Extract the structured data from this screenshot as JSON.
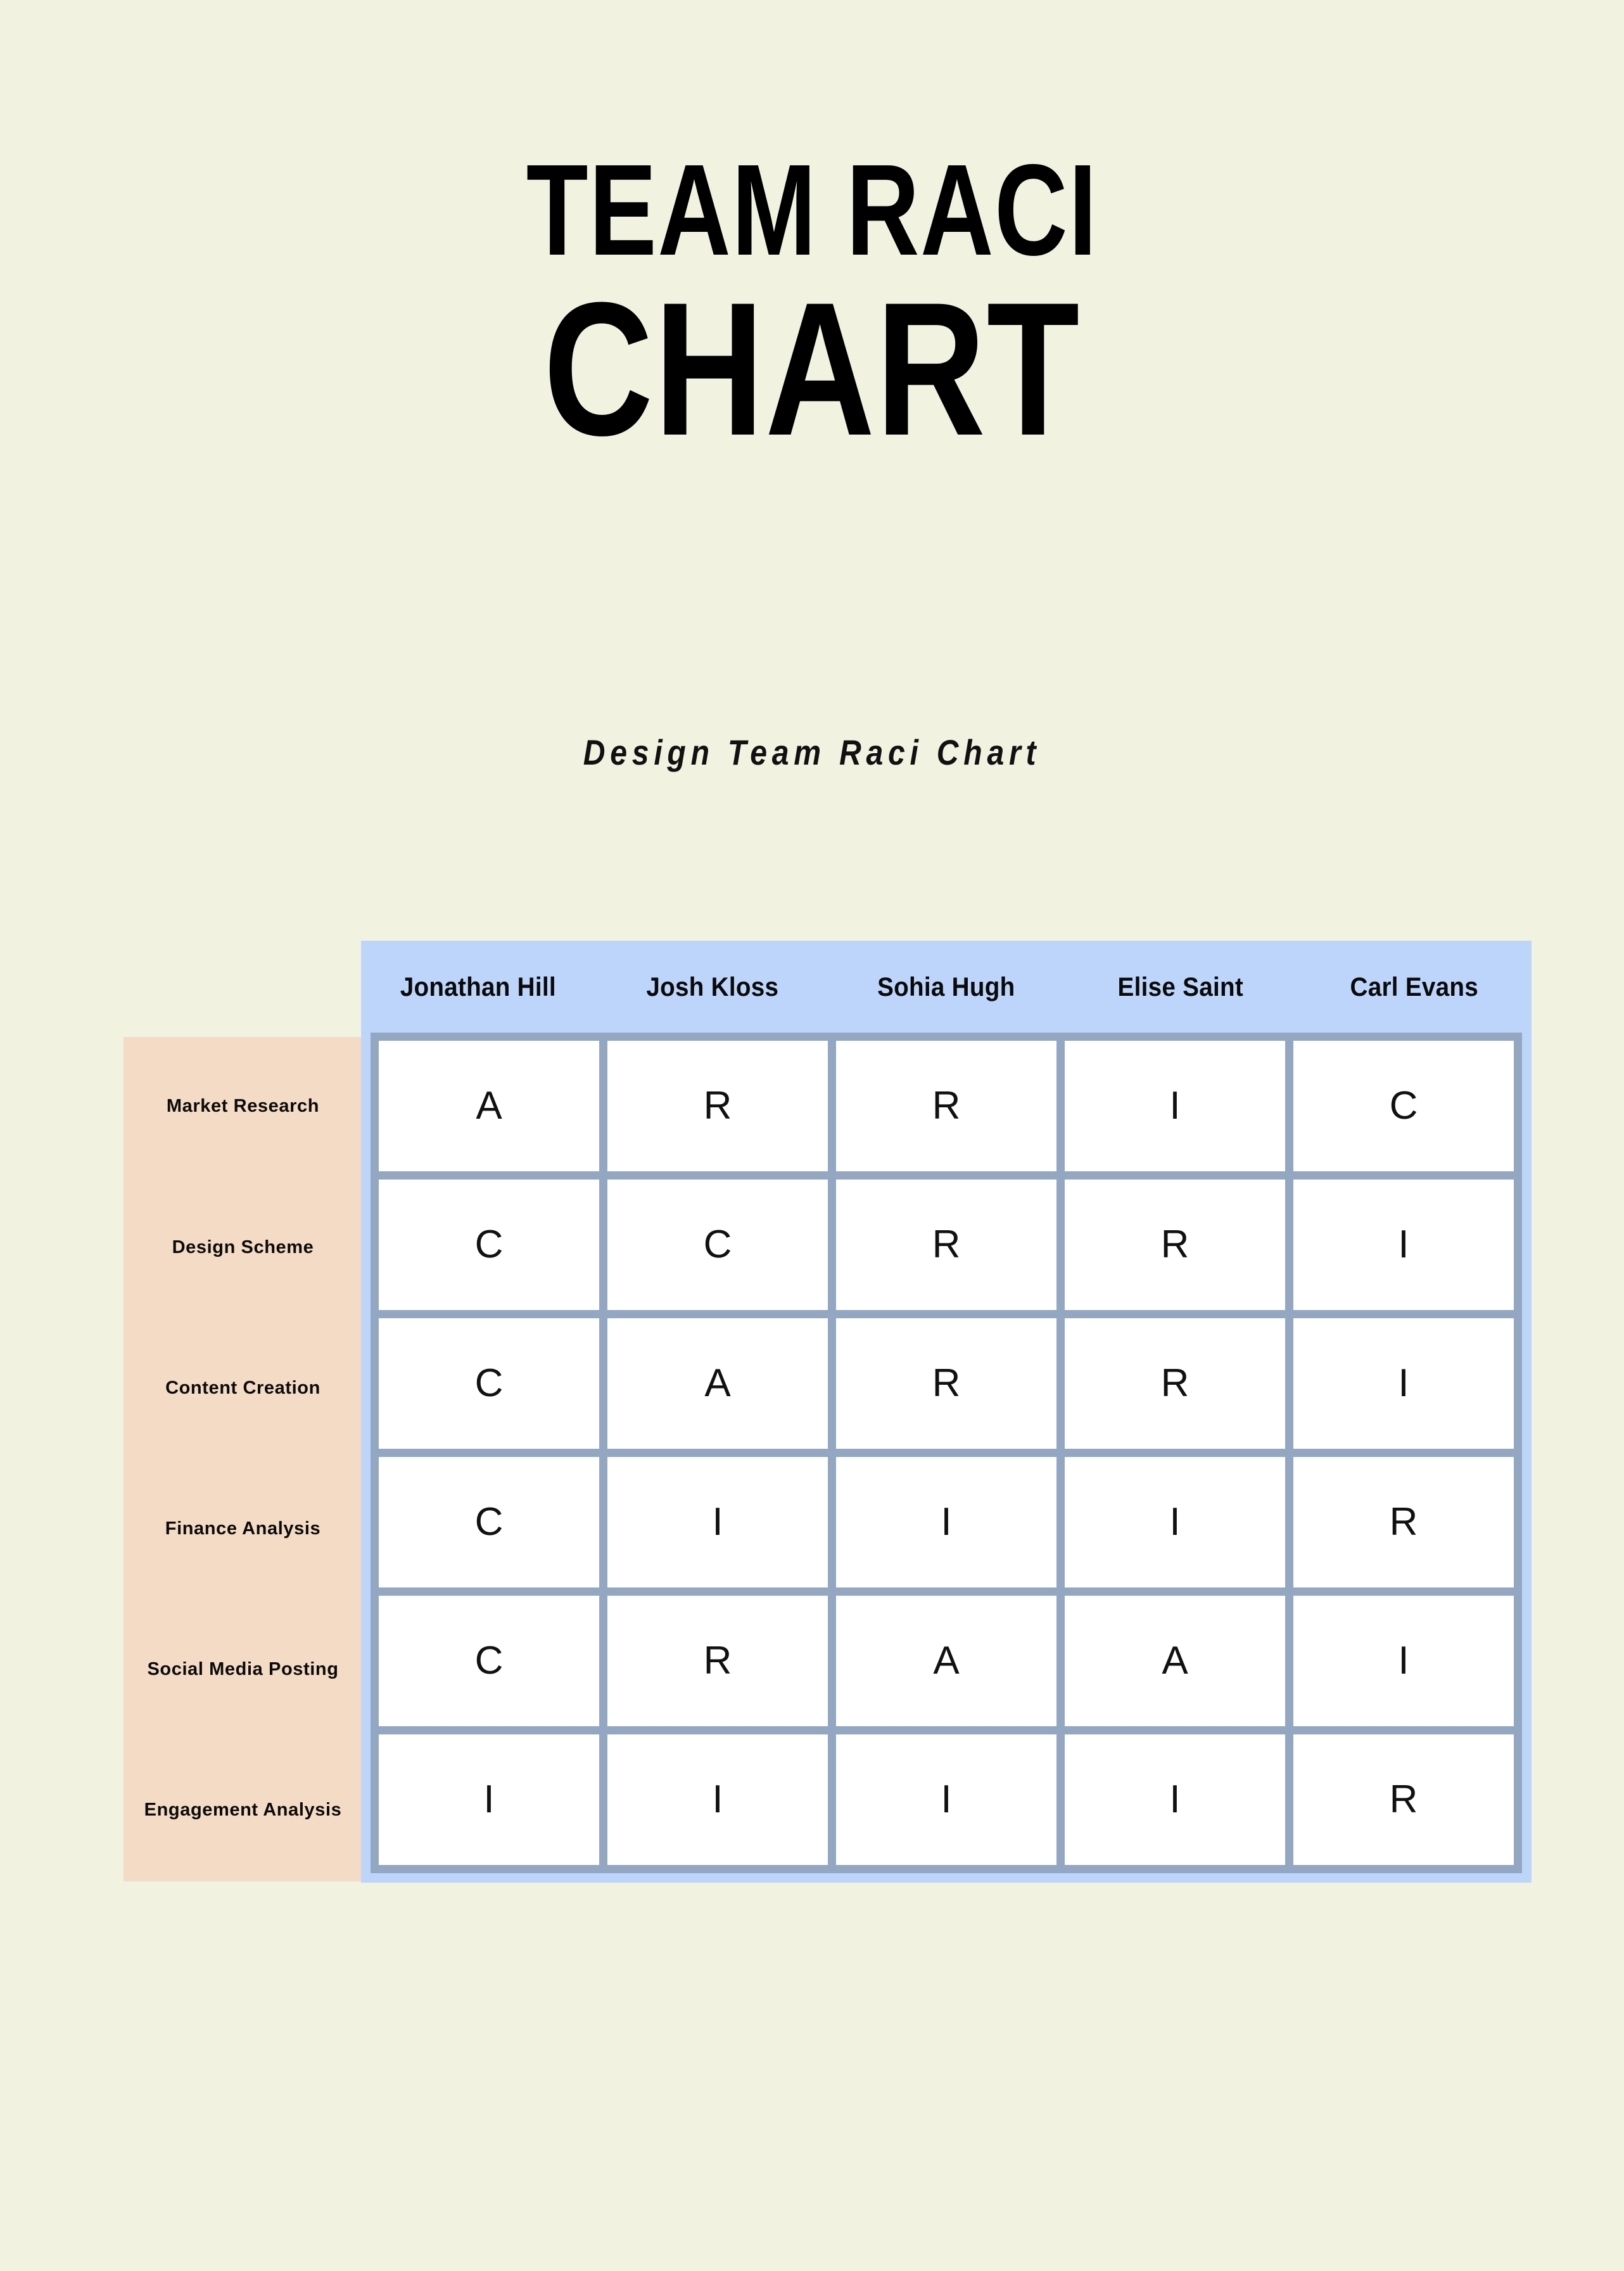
{
  "title": {
    "line1": "TEAM RACI",
    "line2": "CHART"
  },
  "subtitle": "Design Team Raci Chart",
  "colors": {
    "page_background": "#f1f3e0",
    "task_panel": "#f4dbc5",
    "grid_panel": "#bed5fb",
    "matrix_border": "#93a7c3",
    "cell_background": "#ffffff",
    "text": "#111111"
  },
  "chart_data": {
    "type": "table",
    "title": "TEAM RACI CHART",
    "subtitle": "Design Team Raci Chart",
    "xlabel": "",
    "ylabel": "",
    "legend": [],
    "columns": [
      "Jonathan Hill",
      "Josh Kloss",
      "Sohia Hugh",
      "Elise Saint",
      "Carl Evans"
    ],
    "rows": [
      "Market Research",
      "Design Scheme",
      "Content Creation",
      "Finance Analysis",
      "Social Media Posting",
      "Engagement Analysis"
    ],
    "values": [
      [
        "A",
        "R",
        "R",
        "I",
        "C"
      ],
      [
        "C",
        "C",
        "R",
        "R",
        "I"
      ],
      [
        "C",
        "A",
        "R",
        "R",
        "I"
      ],
      [
        "C",
        "I",
        "I",
        "I",
        "R"
      ],
      [
        "C",
        "R",
        "A",
        "A",
        "I"
      ],
      [
        "I",
        "I",
        "I",
        "I",
        "R"
      ]
    ]
  }
}
